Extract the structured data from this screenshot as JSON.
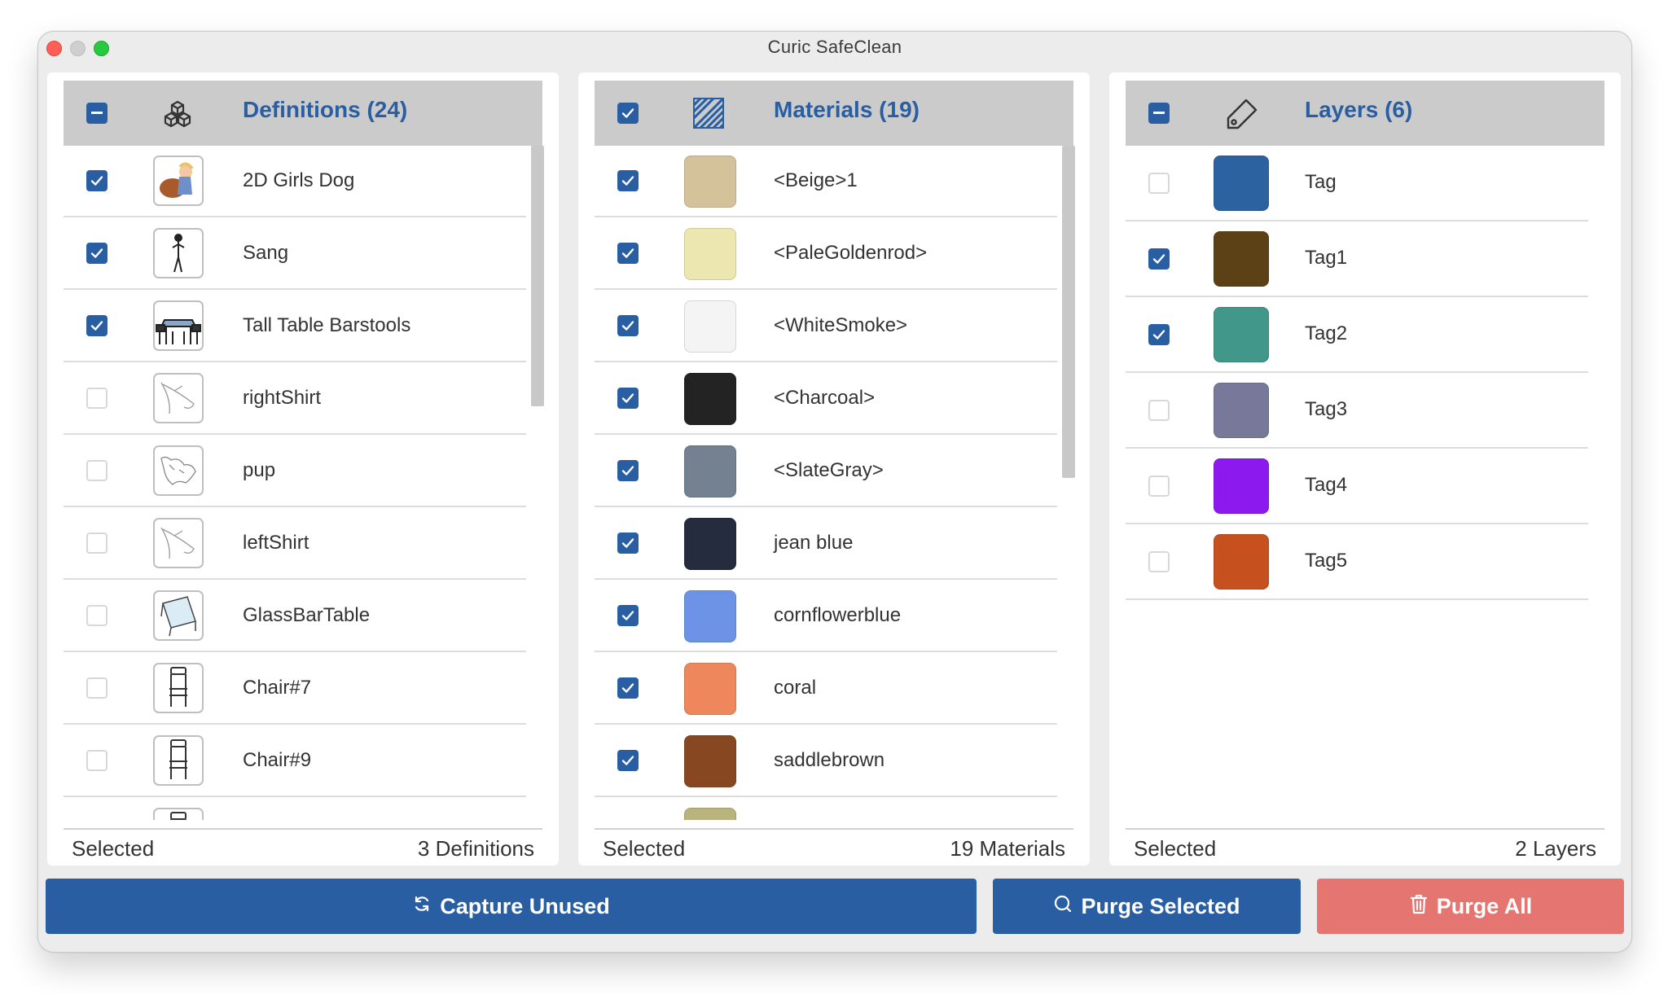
{
  "window": {
    "title": "Curic SafeClean"
  },
  "definitions": {
    "title": "Definitions (24)",
    "header_check_state": "indeterminate",
    "rows": [
      {
        "name": "2D Girls Dog",
        "checked": true,
        "thumb": "girl-dog-icon"
      },
      {
        "name": "Sang",
        "checked": true,
        "thumb": "person-icon"
      },
      {
        "name": "Tall Table Barstools",
        "checked": true,
        "thumb": "table-stools-icon"
      },
      {
        "name": "rightShirt",
        "checked": false,
        "thumb": "shirt-icon"
      },
      {
        "name": "pup",
        "checked": false,
        "thumb": "dog-icon"
      },
      {
        "name": "leftShirt",
        "checked": false,
        "thumb": "shirt-icon"
      },
      {
        "name": "GlassBarTable",
        "checked": false,
        "thumb": "glass-table-icon"
      },
      {
        "name": "Chair#7",
        "checked": false,
        "thumb": "chair-icon"
      },
      {
        "name": "Chair#9",
        "checked": false,
        "thumb": "chair-icon"
      },
      {
        "name": "",
        "checked": false,
        "thumb": "chair-icon"
      }
    ],
    "footer_left": "Selected",
    "footer_right": "3 Definitions"
  },
  "materials": {
    "title": "Materials (19)",
    "header_check_state": "checked",
    "rows": [
      {
        "name": "<Beige>1",
        "checked": true,
        "color": "#d4c29a"
      },
      {
        "name": "<PaleGoldenrod>",
        "checked": true,
        "color": "#ece6b0"
      },
      {
        "name": "<WhiteSmoke>",
        "checked": true,
        "color": "#f4f4f4"
      },
      {
        "name": "<Charcoal>",
        "checked": true,
        "color": "#232323"
      },
      {
        "name": "<SlateGray>",
        "checked": true,
        "color": "#738191"
      },
      {
        "name": "jean blue",
        "checked": true,
        "color": "#252c3e"
      },
      {
        "name": "cornflowerblue",
        "checked": true,
        "color": "#6d93e6"
      },
      {
        "name": "coral",
        "checked": true,
        "color": "#ee875b"
      },
      {
        "name": "saddlebrown",
        "checked": true,
        "color": "#874821"
      },
      {
        "name": "",
        "checked": true,
        "color": "#b8b47c"
      }
    ],
    "footer_left": "Selected",
    "footer_right": "19 Materials"
  },
  "layers": {
    "title": "Layers (6)",
    "header_check_state": "indeterminate",
    "rows": [
      {
        "name": "Tag",
        "checked": false,
        "color": "#2c62a0"
      },
      {
        "name": "Tag1",
        "checked": true,
        "color": "#5b4115"
      },
      {
        "name": "Tag2",
        "checked": true,
        "color": "#40978a"
      },
      {
        "name": "Tag3",
        "checked": false,
        "color": "#78799a"
      },
      {
        "name": "Tag4",
        "checked": false,
        "color": "#8c1aef"
      },
      {
        "name": "Tag5",
        "checked": false,
        "color": "#c6511f"
      }
    ],
    "footer_left": "Selected",
    "footer_right": "2 Layers"
  },
  "buttons": {
    "capture": "Capture Unused",
    "purge_selected": "Purge Selected",
    "purge_all": "Purge All"
  },
  "colors": {
    "accent": "#2a5ea2",
    "danger": "#e57571",
    "header_bg": "#cbcbcb"
  }
}
